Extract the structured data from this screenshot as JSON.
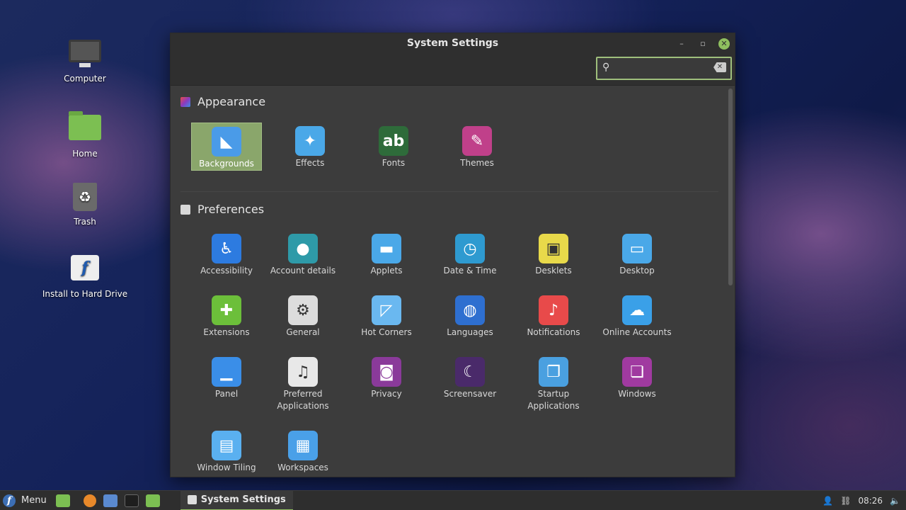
{
  "desktop": {
    "icons": [
      {
        "label": "Computer",
        "icon": "computer-icon"
      },
      {
        "label": "Home",
        "icon": "home-folder-icon"
      },
      {
        "label": "Trash",
        "icon": "trash-icon"
      },
      {
        "label": "Install to Hard Drive",
        "icon": "install-icon"
      }
    ]
  },
  "window": {
    "title": "System Settings",
    "minimize": "–",
    "restore": "▫",
    "close": "✕",
    "search": {
      "value": "",
      "placeholder": "",
      "icon": "search-icon",
      "clear": "✕"
    }
  },
  "sections": [
    {
      "title": "Appearance",
      "items": [
        {
          "label": "Backgrounds",
          "icon": "backgrounds-icon",
          "color": "#4a9be8",
          "glyph": "◣",
          "selected": true
        },
        {
          "label": "Effects",
          "icon": "effects-icon",
          "color": "#4aa8e8",
          "glyph": "✦"
        },
        {
          "label": "Fonts",
          "icon": "fonts-icon",
          "color": "#2e6b3a",
          "glyph": "ab"
        },
        {
          "label": "Themes",
          "icon": "themes-icon",
          "color": "#c0408a",
          "glyph": "✎"
        }
      ]
    },
    {
      "title": "Preferences",
      "items": [
        {
          "label": "Accessibility",
          "icon": "accessibility-icon",
          "color": "#2d7be0",
          "glyph": "♿"
        },
        {
          "label": "Account details",
          "icon": "account-icon",
          "color": "#2e9aa8",
          "glyph": "●"
        },
        {
          "label": "Applets",
          "icon": "applets-icon",
          "color": "#4aa8e8",
          "glyph": "▬"
        },
        {
          "label": "Date & Time",
          "icon": "clock-icon",
          "color": "#2e9ad0",
          "glyph": "◷"
        },
        {
          "label": "Desklets",
          "icon": "desklets-icon",
          "color": "#e8d94a",
          "glyph": "▣"
        },
        {
          "label": "Desktop",
          "icon": "desktop-icon",
          "color": "#4aa8e8",
          "glyph": "▭"
        },
        {
          "label": "Extensions",
          "icon": "extensions-icon",
          "color": "#6cbf3a",
          "glyph": "✚"
        },
        {
          "label": "General",
          "icon": "general-icon",
          "color": "#dcdcdc",
          "glyph": "⚙"
        },
        {
          "label": "Hot Corners",
          "icon": "hot-corners-icon",
          "color": "#6ab8f0",
          "glyph": "◸"
        },
        {
          "label": "Languages",
          "icon": "languages-icon",
          "color": "#2e6fd0",
          "glyph": "◍"
        },
        {
          "label": "Notifications",
          "icon": "bell-icon",
          "color": "#e84a4a",
          "glyph": "♪"
        },
        {
          "label": "Online Accounts",
          "icon": "cloud-icon",
          "color": "#3aa0e8",
          "glyph": "☁"
        },
        {
          "label": "Panel",
          "icon": "panel-icon",
          "color": "#3a8ee8",
          "glyph": "▁"
        },
        {
          "label": "Preferred Applications",
          "icon": "preferred-apps-icon",
          "color": "#e8e8e8",
          "glyph": "♫"
        },
        {
          "label": "Privacy",
          "icon": "privacy-icon",
          "color": "#8a3a9a",
          "glyph": "◙"
        },
        {
          "label": "Screensaver",
          "icon": "moon-icon",
          "color": "#4a2a6a",
          "glyph": "☾"
        },
        {
          "label": "Startup Applications",
          "icon": "startup-icon",
          "color": "#4aa0e0",
          "glyph": "❐"
        },
        {
          "label": "Windows",
          "icon": "windows-icon",
          "color": "#a03aa0",
          "glyph": "❏"
        },
        {
          "label": "Window Tiling",
          "icon": "tiling-icon",
          "color": "#5ab0f0",
          "glyph": "▤"
        },
        {
          "label": "Workspaces",
          "icon": "workspaces-icon",
          "color": "#4aa0e8",
          "glyph": "▦"
        }
      ]
    }
  ],
  "taskbar": {
    "menu_label": "Menu",
    "menu_logo": "f",
    "task_label": "System Settings",
    "clock": "08:26",
    "tray_icons": [
      "user-icon",
      "network-icon",
      "volume-icon"
    ]
  }
}
